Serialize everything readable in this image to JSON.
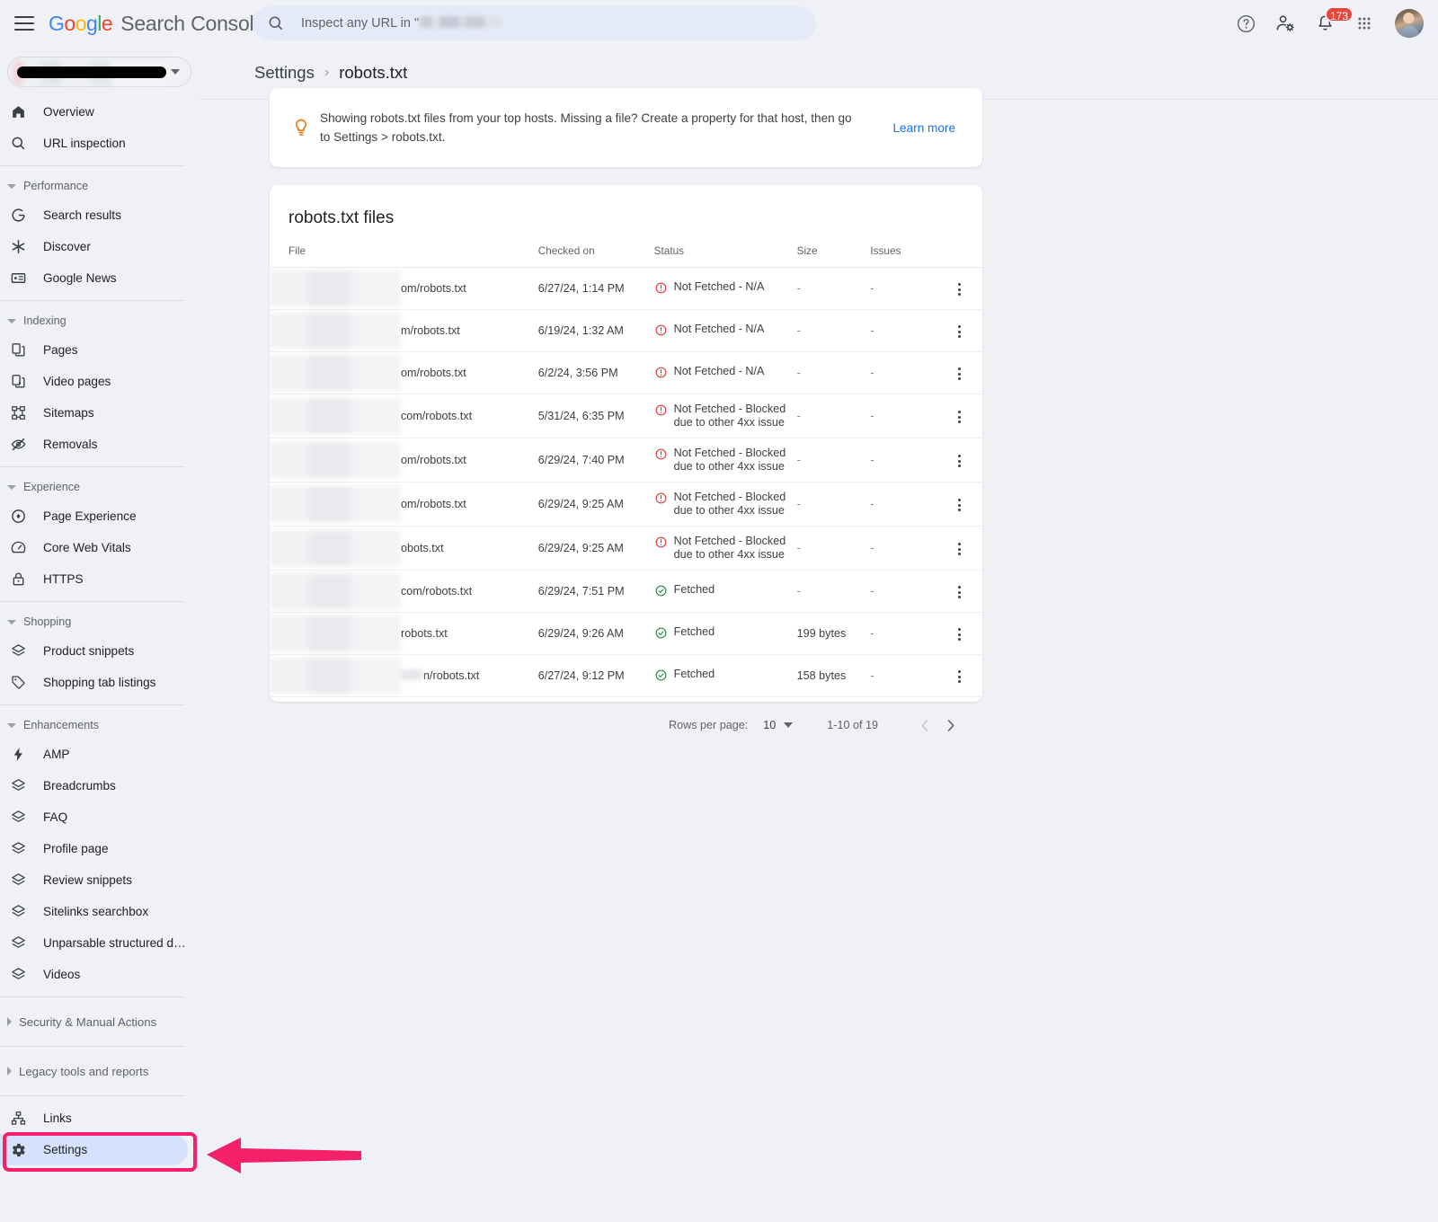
{
  "header": {
    "brand_google": "Google",
    "brand_product": "Search Console",
    "menu_icon": "hamburger-icon",
    "search": {
      "placeholder_prefix": "Inspect any URL in \"",
      "icon": "search-icon"
    },
    "icons": {
      "help": "help-icon",
      "account_settings": "account-settings-icon",
      "notifications": "notifications-bell-icon",
      "apps": "apps-grid-icon",
      "avatar": "user-avatar"
    },
    "notification_count": "173"
  },
  "sidebar": {
    "property_selector": {
      "value": "",
      "caret": "chevron-down-icon"
    },
    "top_items": [
      {
        "label": "Overview",
        "icon": "home-icon"
      },
      {
        "label": "URL inspection",
        "icon": "search-icon"
      }
    ],
    "groups": [
      {
        "title": "Performance",
        "expanded": true,
        "items": [
          {
            "label": "Search results",
            "icon": "google-g-icon"
          },
          {
            "label": "Discover",
            "icon": "discover-asterisk-icon"
          },
          {
            "label": "Google News",
            "icon": "news-card-icon"
          }
        ]
      },
      {
        "title": "Indexing",
        "expanded": true,
        "items": [
          {
            "label": "Pages",
            "icon": "pages-copy-icon"
          },
          {
            "label": "Video pages",
            "icon": "video-page-icon"
          },
          {
            "label": "Sitemaps",
            "icon": "sitemap-icon"
          },
          {
            "label": "Removals",
            "icon": "eye-off-icon"
          }
        ]
      },
      {
        "title": "Experience",
        "expanded": true,
        "items": [
          {
            "label": "Page Experience",
            "icon": "page-experience-icon"
          },
          {
            "label": "Core Web Vitals",
            "icon": "speedometer-icon"
          },
          {
            "label": "HTTPS",
            "icon": "lock-icon"
          }
        ]
      },
      {
        "title": "Shopping",
        "expanded": true,
        "items": [
          {
            "label": "Product snippets",
            "icon": "layers-icon"
          },
          {
            "label": "Shopping tab listings",
            "icon": "tag-icon"
          }
        ]
      },
      {
        "title": "Enhancements",
        "expanded": true,
        "items": [
          {
            "label": "AMP",
            "icon": "bolt-icon"
          },
          {
            "label": "Breadcrumbs",
            "icon": "layers-icon"
          },
          {
            "label": "FAQ",
            "icon": "layers-icon"
          },
          {
            "label": "Profile page",
            "icon": "layers-icon"
          },
          {
            "label": "Review snippets",
            "icon": "layers-icon"
          },
          {
            "label": "Sitelinks searchbox",
            "icon": "layers-icon"
          },
          {
            "label": "Unparsable structured d…",
            "icon": "layers-icon"
          },
          {
            "label": "Videos",
            "icon": "layers-icon"
          }
        ]
      }
    ],
    "collapsed_groups": [
      {
        "label": "Security & Manual Actions"
      },
      {
        "label": "Legacy tools and reports"
      }
    ],
    "bottom_items": [
      {
        "label": "Links",
        "icon": "links-sitemap-icon",
        "active": false
      },
      {
        "label": "Settings",
        "icon": "gear-icon",
        "active": true
      }
    ]
  },
  "breadcrumb": {
    "parent": "Settings",
    "separator": "›",
    "current": "robots.txt"
  },
  "banner": {
    "icon": "lightbulb-icon",
    "text": "Showing robots.txt files from your top hosts. Missing a file? Create a property for that host, then go to Settings > robots.txt.",
    "link": "Learn more"
  },
  "table": {
    "title": "robots.txt files",
    "columns": [
      "File",
      "Checked on",
      "Status",
      "Size",
      "Issues"
    ],
    "rows": [
      {
        "file": "om/robots.txt",
        "checked_on": "6/27/24, 1:14 PM",
        "status": "Not Fetched - N/A",
        "state": "error",
        "size": "-",
        "issues": "-"
      },
      {
        "file": "m/robots.txt",
        "checked_on": "6/19/24, 1:32 AM",
        "status": "Not Fetched - N/A",
        "state": "error",
        "size": "-",
        "issues": "-"
      },
      {
        "file": "om/robots.txt",
        "checked_on": "6/2/24, 3:56 PM",
        "status": "Not Fetched - N/A",
        "state": "error",
        "size": "-",
        "issues": "-"
      },
      {
        "file": "com/robots.txt",
        "checked_on": "5/31/24, 6:35 PM",
        "status": "Not Fetched - Blocked due to other 4xx issue",
        "state": "error",
        "size": "-",
        "issues": "-"
      },
      {
        "file": "om/robots.txt",
        "checked_on": "6/29/24, 7:40 PM",
        "status": "Not Fetched - Blocked due to other 4xx issue",
        "state": "error",
        "size": "-",
        "issues": "-"
      },
      {
        "file": "om/robots.txt",
        "checked_on": "6/29/24, 9:25 AM",
        "status": "Not Fetched - Blocked due to other 4xx issue",
        "state": "error",
        "size": "-",
        "issues": "-"
      },
      {
        "file": "obots.txt",
        "checked_on": "6/29/24, 9:25 AM",
        "status": "Not Fetched - Blocked due to other 4xx issue",
        "state": "error",
        "size": "-",
        "issues": "-"
      },
      {
        "file": "com/robots.txt",
        "checked_on": "6/29/24, 7:51 PM",
        "status": "Fetched",
        "state": "ok",
        "size": "-",
        "issues": "-"
      },
      {
        "file": "robots.txt",
        "checked_on": "6/29/24, 9:26 AM",
        "status": "Fetched",
        "state": "ok",
        "size": "199 bytes",
        "issues": "-"
      },
      {
        "file": "n/robots.txt",
        "checked_on": "6/27/24, 9:12 PM",
        "status": "Fetched",
        "state": "ok",
        "size": "158 bytes",
        "issues": "-",
        "file_blur_prefix": true
      }
    ],
    "row_menu_icon": "more-vertical-icon"
  },
  "pagination": {
    "rows_per_page_label": "Rows per page:",
    "rows_per_page_value": "10",
    "range": "1-10 of 19",
    "prev_icon": "chevron-left-icon",
    "next_icon": "chevron-right-icon"
  },
  "annotation": {
    "color": "#f5206a",
    "highlight_target": "Settings",
    "arrow": "left-pointing-arrow"
  },
  "colors": {
    "background": "#eff1f4",
    "card": "#ffffff",
    "accent_blue": "#1a73e8",
    "active_nav": "#d6e2fb",
    "error_red": "#d93025",
    "success_green": "#188038",
    "bulb_orange": "#e8710a",
    "badge_red": "#e8453c"
  }
}
